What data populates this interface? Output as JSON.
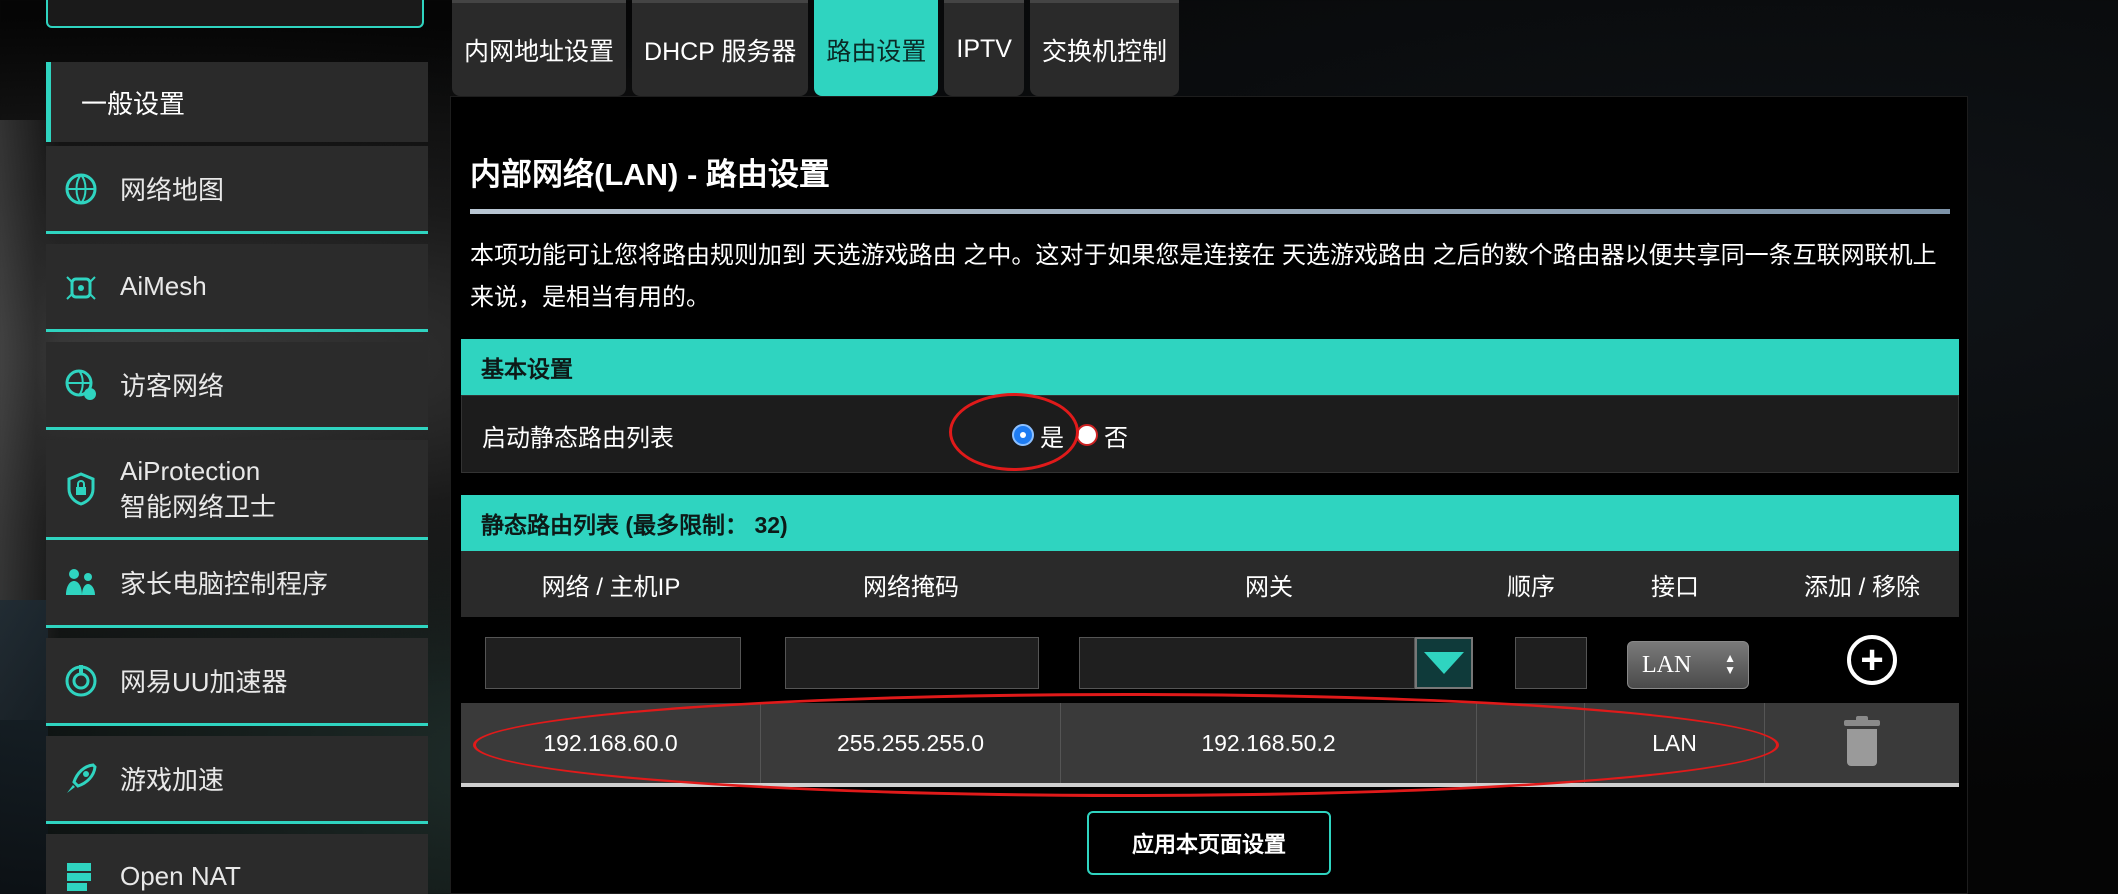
{
  "sidebar": {
    "active": "一般设置",
    "items": [
      {
        "label": "网络地图",
        "icon": "globe-icon"
      },
      {
        "label": "AiMesh",
        "icon": "mesh-node-icon"
      },
      {
        "label": "访客网络",
        "icon": "guest-globe-icon"
      },
      {
        "label": "AiProtection\n智能网络卫士",
        "icon": "shield-lock-icon"
      },
      {
        "label": "家长电脑控制程序",
        "icon": "parents-icon"
      },
      {
        "label": "网易UU加速器",
        "icon": "uu-icon"
      },
      {
        "label": "游戏加速",
        "icon": "rocket-icon"
      },
      {
        "label": "Open NAT",
        "icon": "server-icon"
      }
    ]
  },
  "tabs": [
    {
      "label": "内网地址设置",
      "active": false
    },
    {
      "label": "DHCP 服务器",
      "active": false
    },
    {
      "label": "路由设置",
      "active": true
    },
    {
      "label": "IPTV",
      "active": false
    },
    {
      "label": "交换机控制",
      "active": false
    }
  ],
  "page": {
    "title": "内部网络(LAN) - 路由设置",
    "description": "本项功能可让您将路由规则加到 天选游戏路由 之中。这对于如果您是连接在 天选游戏路由 之后的数个路由器以便共享同一条互联网联机上来说，是相当有用的。"
  },
  "basic": {
    "header": "基本设置",
    "enable_label": "启动静态路由列表",
    "yes": "是",
    "no": "否",
    "selected": "是"
  },
  "route_table": {
    "header": "静态路由列表 (最多限制： 32)",
    "columns": [
      "网络 / 主机IP",
      "网络掩码",
      "网关",
      "顺序",
      "接口",
      "添加 / 移除"
    ],
    "new_interface": "LAN",
    "rows": [
      {
        "network": "192.168.60.0",
        "netmask": "255.255.255.0",
        "gateway": "192.168.50.2",
        "metric": "",
        "interface": "LAN"
      }
    ]
  },
  "apply_label": "应用本页面设置",
  "colors": {
    "accent": "#2fd4c0",
    "annotation": "#e01a1a"
  }
}
